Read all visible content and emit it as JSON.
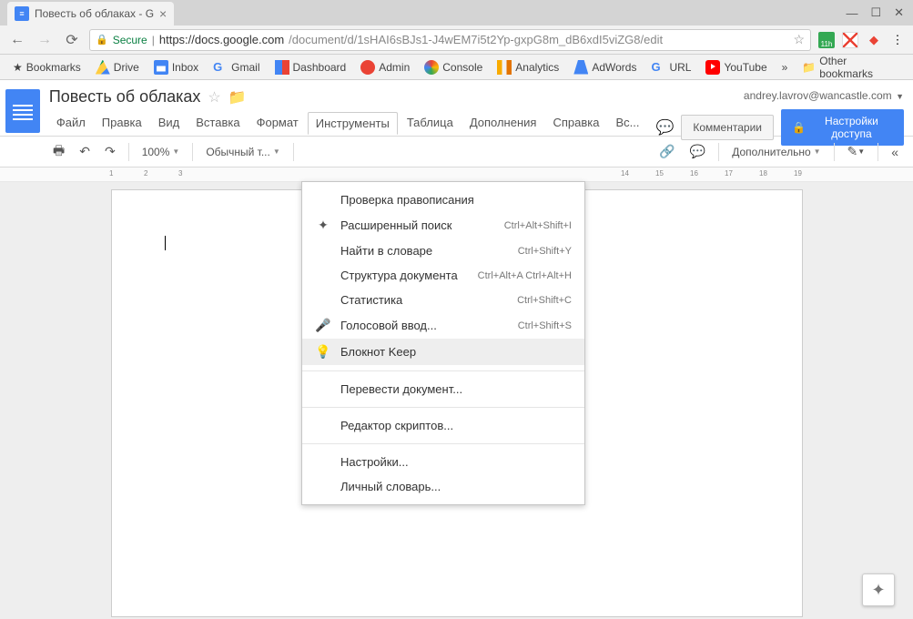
{
  "browser": {
    "tab_title": "Повесть об облаках - G",
    "url_secure_label": "Secure",
    "url_host": "https://docs.google.com",
    "url_path": "/document/d/1sHAI6sBJs1-J4wEM7i5t2Yp-gxpG8m_dB6xdI5viZG8/edit",
    "window_min": "—",
    "window_max": "☐",
    "window_close": "✕"
  },
  "bookmarks": {
    "label": "Bookmarks",
    "items": [
      "Drive",
      "Inbox",
      "Gmail",
      "Dashboard",
      "Admin",
      "Console",
      "Analytics",
      "AdWords",
      "URL",
      "YouTube"
    ],
    "other": "Other bookmarks"
  },
  "header": {
    "doc_title": "Повесть об облаках",
    "user_email": "andrey.lavrov@wancastle.com",
    "comments_btn": "Комментарии",
    "share_btn": "Настройки доступа"
  },
  "menus": [
    "Файл",
    "Правка",
    "Вид",
    "Вставка",
    "Формат",
    "Инструменты",
    "Таблица",
    "Дополнения",
    "Справка",
    "Вс..."
  ],
  "active_menu_index": 5,
  "toolbar": {
    "zoom": "100%",
    "style": "Обычный т...",
    "more": "Дополнительно"
  },
  "ruler_marks": [
    "1",
    "2",
    "3",
    "14",
    "15",
    "16",
    "17",
    "18",
    "19"
  ],
  "tools_menu": [
    {
      "icon": "",
      "label": "Проверка правописания",
      "shortcut": ""
    },
    {
      "icon": "✦",
      "label": "Расширенный поиск",
      "shortcut": "Ctrl+Alt+Shift+I"
    },
    {
      "icon": "",
      "label": "Найти в словаре",
      "shortcut": "Ctrl+Shift+Y"
    },
    {
      "icon": "",
      "label": "Структура документа",
      "shortcut": "Ctrl+Alt+A Ctrl+Alt+H"
    },
    {
      "icon": "",
      "label": "Статистика",
      "shortcut": "Ctrl+Shift+C"
    },
    {
      "icon": "🎤",
      "label": "Голосовой ввод...",
      "shortcut": "Ctrl+Shift+S"
    },
    {
      "icon": "💡",
      "label": "Блокнот Keep",
      "shortcut": "",
      "hover": true
    },
    {
      "sep": true
    },
    {
      "icon": "",
      "label": "Перевести документ...",
      "shortcut": ""
    },
    {
      "sep": true
    },
    {
      "icon": "",
      "label": "Редактор скриптов...",
      "shortcut": ""
    },
    {
      "sep": true
    },
    {
      "icon": "",
      "label": "Настройки...",
      "shortcut": ""
    },
    {
      "icon": "",
      "label": "Личный словарь...",
      "shortcut": ""
    }
  ]
}
